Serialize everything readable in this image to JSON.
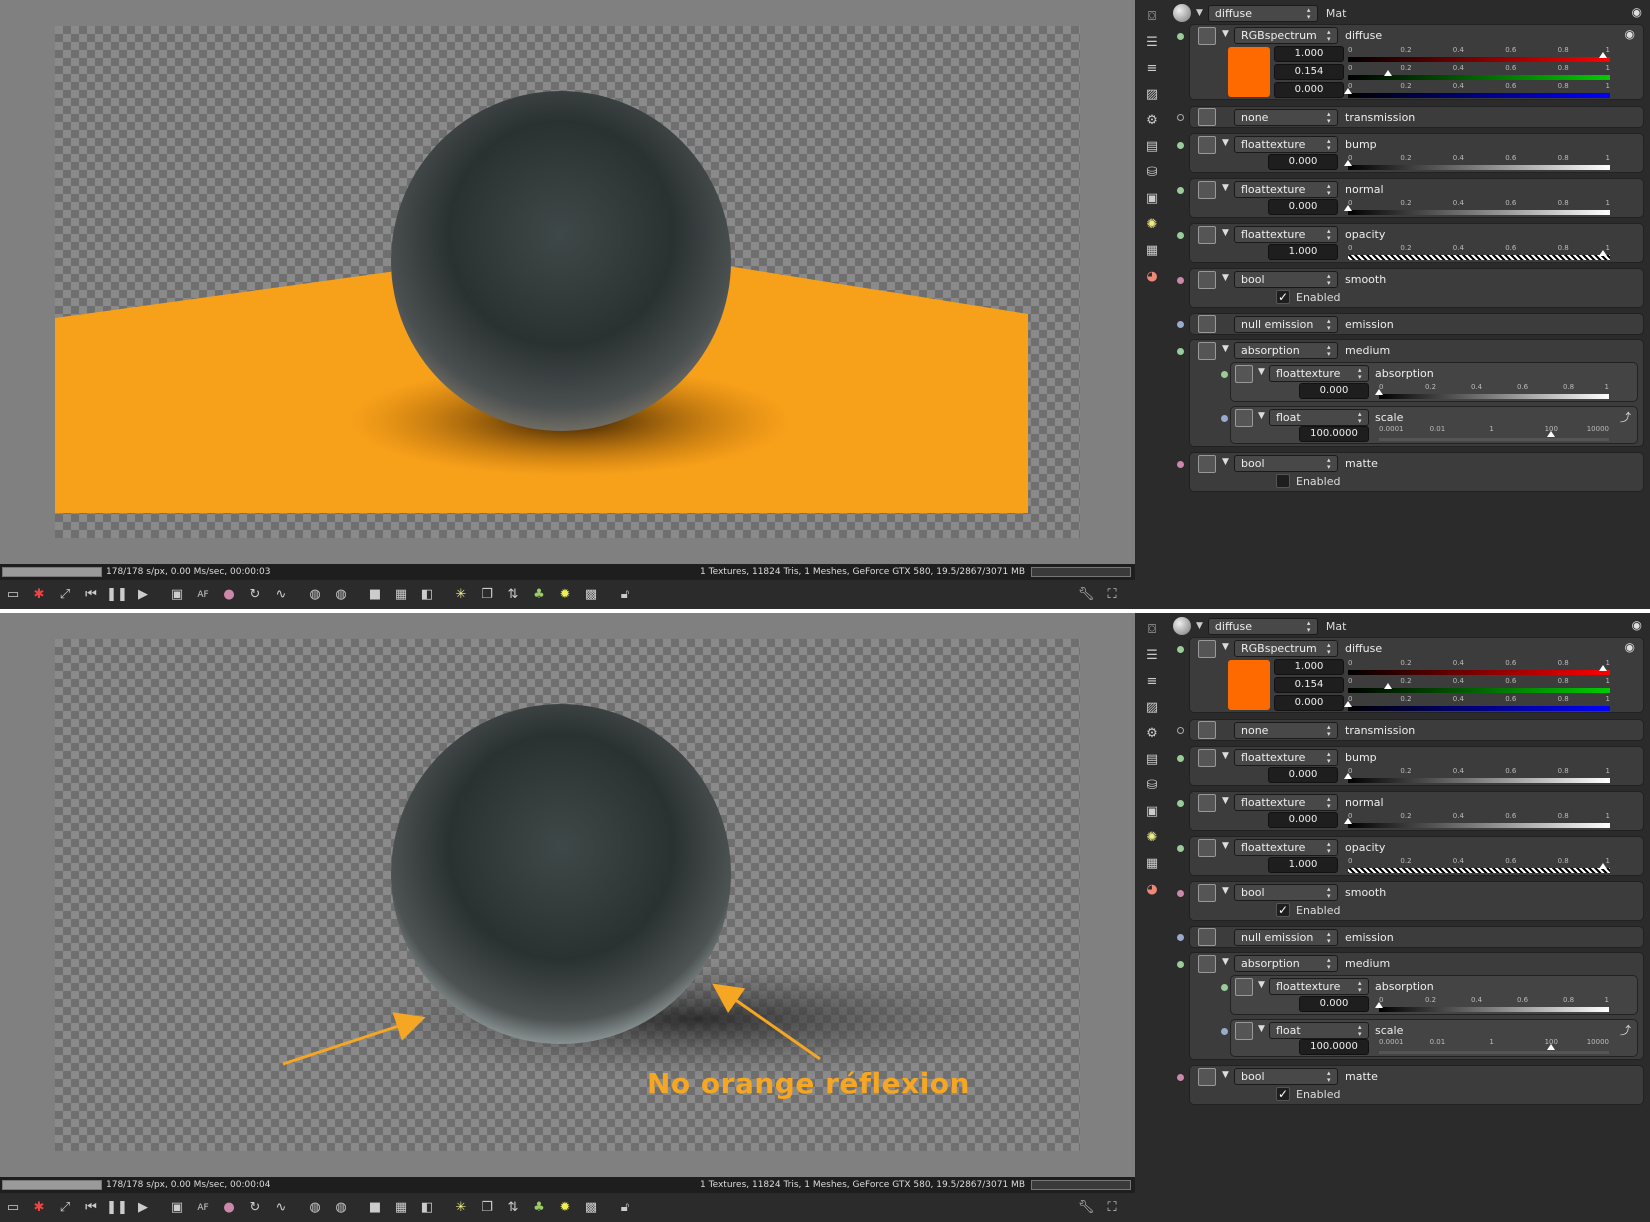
{
  "status": {
    "top_left": "178/178 s/px, 0.00 Ms/sec, 00:00:03",
    "bottom_left": "178/178 s/px, 0.00 Ms/sec, 00:00:04",
    "right": "1 Textures, 11824 Tris, 1 Meshes, GeForce GTX 580, 19.5/2867/3071 MB",
    "progress": 1.0
  },
  "toolbar_icons": [
    "render-region-icon",
    "stop-icon",
    "resize-icon",
    "skip-back-icon",
    "pause-icon",
    "play-icon",
    "monitor-icon",
    "af-icon",
    "color-icon",
    "refresh-icon",
    "link-icon",
    "sphere-icon",
    "sphere2-icon",
    "square-icon",
    "checker-icon",
    "half-icon",
    "sparkle-icon",
    "copy-icon",
    "arrows-icon",
    "tree-icon",
    "light-icon",
    "image-icon",
    "lock-icon"
  ],
  "sidebar_icons": [
    "camera-icon",
    "layers-icon",
    "list-icon",
    "image-icon",
    "settings-icon",
    "panel-icon",
    "database-icon",
    "picture-icon",
    "sun-icon",
    "texture-icon",
    "material-icon"
  ],
  "header": {
    "shader": "diffuse",
    "mat": "Mat"
  },
  "sections": {
    "diffuse": {
      "type": "RGBspectrum",
      "label": "diffuse",
      "r": "1.000",
      "g": "0.154",
      "b": "0.000",
      "swatch_color": "#ff6a00"
    },
    "transmission": {
      "type": "none",
      "label": "transmission"
    },
    "bump": {
      "type": "floattexture",
      "label": "bump",
      "value": "0.000"
    },
    "normal": {
      "type": "floattexture",
      "label": "normal",
      "value": "0.000"
    },
    "opacity": {
      "type": "floattexture",
      "label": "opacity",
      "value": "1.000"
    },
    "smooth": {
      "type": "bool",
      "label": "smooth",
      "enabled_label": "Enabled"
    },
    "emission": {
      "type": "null emission",
      "label": "emission"
    },
    "medium": {
      "type": "absorption",
      "label": "medium",
      "absorption": {
        "type": "floattexture",
        "label": "absorption",
        "value": "0.000"
      },
      "scale": {
        "type": "float",
        "label": "scale",
        "value": "100.0000"
      }
    },
    "matte": {
      "type": "bool",
      "label": "matte",
      "enabled_label": "Enabled"
    }
  },
  "ramp_ticks": [
    "0",
    "0.2",
    "0.4",
    "0.6",
    "0.8",
    "1"
  ],
  "scale_ticks": [
    "0.0001",
    "0.01",
    "1",
    "100",
    "10000"
  ],
  "annotation": "No orange réflexion"
}
